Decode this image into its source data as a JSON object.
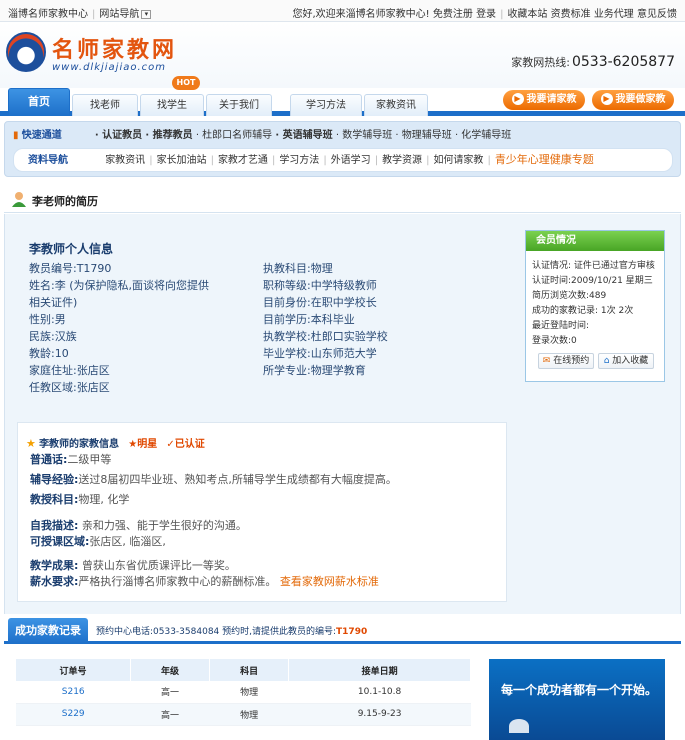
{
  "topbar": {
    "site_name": "淄博名师家教中心",
    "site_nav": "网站导航",
    "welcome": "您好,欢迎来淄博名师家教中心!",
    "register": "免费注册",
    "login": "登录",
    "links": [
      "收藏本站",
      "资费标准",
      "业务代理",
      "意见反馈"
    ]
  },
  "header": {
    "logo_title": "名师家教网",
    "logo_url": "www.dlkjiajiao.com",
    "hotline_label": "家教网热线:",
    "hotline_number": "0533-6205877"
  },
  "nav": {
    "tabs": [
      "首页",
      "找老师",
      "找学生",
      "关于我们",
      "学习方法",
      "家教资讯"
    ],
    "hot_badge": "HOT",
    "btn_hire_tutor": "我要请家教",
    "btn_be_tutor": "我要做家教"
  },
  "subnav": {
    "row1_label": "快速通道",
    "row1_items": [
      "· 认证教员",
      "· 推荐教员",
      "· 杜郎口名师辅导",
      "· 英语辅导班",
      "· 数学辅导班",
      "· 物理辅导班",
      "· 化学辅导班"
    ],
    "row2_label": "资料导航",
    "row2_items": [
      "家教资讯",
      "家长加油站",
      "家教才艺通",
      "学习方法",
      "外语学习",
      "教学资源",
      "如何请家教"
    ],
    "row2_highlight": "青少年心理健康专题"
  },
  "resume": {
    "section_title": "李老师的简历",
    "info_title": "李教师个人信息",
    "left_col": [
      "教员编号:T1790",
      "姓名:李 (为保护隐私,面谈将向您提供",
      "相关证件)",
      "性别:男",
      "民族:汉族",
      "教龄:10",
      "家庭住址:张店区",
      "任教区域:张店区"
    ],
    "right_col": [
      "执教科目:物理",
      "职称等级:中学特级教师",
      "目前身份:在职中学校长",
      "目前学历:本科毕业",
      "执教学校:杜郎口实验学校",
      "毕业学校:山东师范大学",
      "所学专业:物理学教育"
    ]
  },
  "member": {
    "title": "会员情况",
    "lines": [
      "认证情况: 证件已通过官方审核",
      "认证时间:2009/10/21 星期三",
      "简历浏览次数:489",
      "成功的家教记录: 1次 2次",
      "最近登陆时间:",
      "登录次数:0"
    ],
    "btn_book": "在线预约",
    "btn_fav": "加入收藏"
  },
  "family": {
    "title": "李教师的家教信息",
    "badge_star": "★明星",
    "badge_verified": "✓已认证",
    "mandarin_label": "普通话:",
    "mandarin_value": "二级甲等",
    "experience_label": "辅导经验:",
    "experience_value": "送过8届初四毕业班、熟知考点,所辅导学生成绩都有大幅度提高。",
    "subjects_label": "教授科目:",
    "subjects_value": "物理, 化学",
    "self_label": "自我描述:",
    "self_value": "亲和力强、能于学生很好的沟通。",
    "area_label": "可授课区域:",
    "area_value": "张店区, 临淄区,",
    "achieve_label": "教学成果:",
    "achieve_value": "曾获山东省优质课评比一等奖。",
    "salary_label": "薪水要求:",
    "salary_value": "严格执行淄博名师家教中心的薪酬标准。",
    "salary_link": "查看家教网薪水标准"
  },
  "success": {
    "tab": "成功家教记录",
    "note_prefix": "预约中心电话:0533-3584084  预约时,请提供此教员的编号:",
    "note_id": "T1790",
    "headers": [
      "订单号",
      "年级",
      "科目",
      "接单日期"
    ],
    "rows": [
      [
        "S216",
        "高一",
        "物理",
        "10.1-10.8"
      ],
      [
        "S229",
        "高一",
        "物理",
        "9.15-9-23"
      ]
    ]
  },
  "banner": {
    "text": "每一个成功者都有一个开始。"
  }
}
